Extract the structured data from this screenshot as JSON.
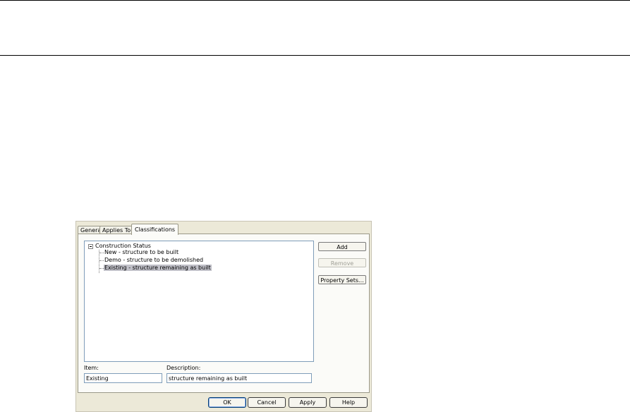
{
  "tabs": [
    "General",
    "Applies To",
    "Classifications"
  ],
  "tree": {
    "root": "Construction Status",
    "children": [
      "New - structure to be built",
      "Demo - structure to be demolished",
      "Existing - structure remaining as built"
    ],
    "selected_index": 2
  },
  "side_buttons": {
    "add": "Add",
    "remove": "Remove",
    "property_sets": "Property Sets..."
  },
  "item": {
    "label": "Item:",
    "value": "Existing"
  },
  "description": {
    "label": "Description:",
    "value": "structure remaining as built"
  },
  "footer_buttons": {
    "ok": "OK",
    "cancel": "Cancel",
    "apply": "Apply",
    "help": "Help"
  }
}
